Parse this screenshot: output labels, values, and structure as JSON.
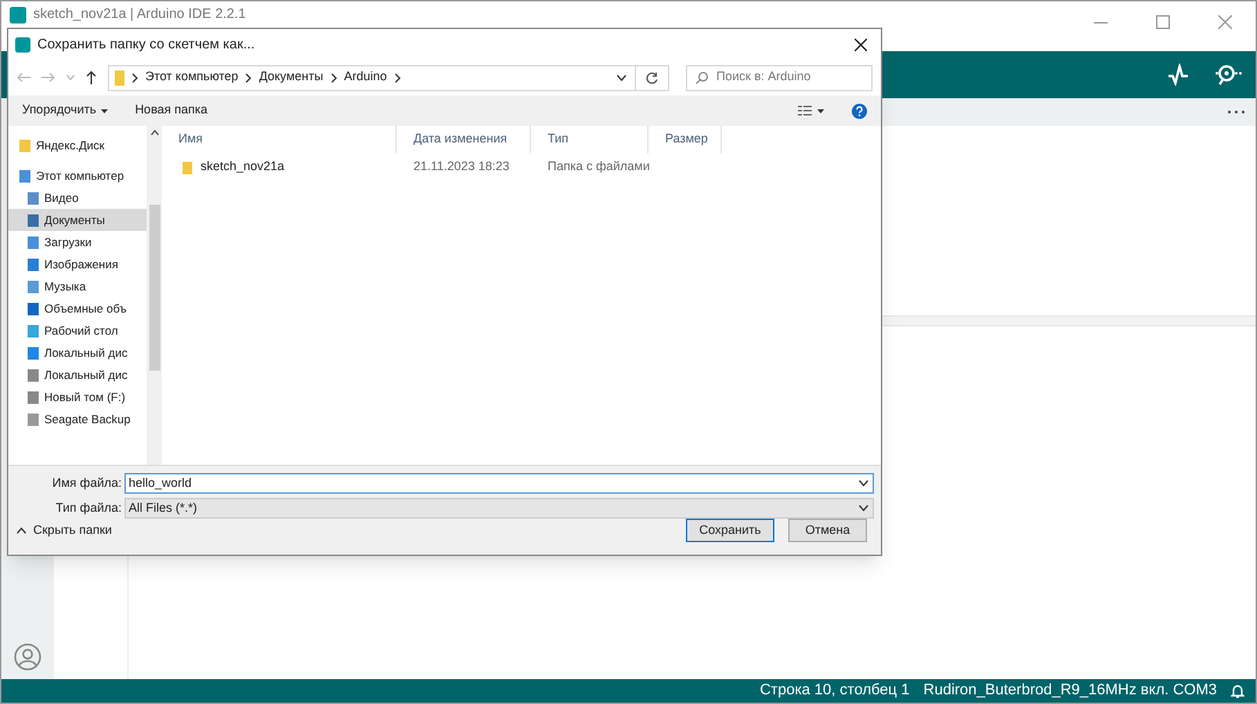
{
  "window": {
    "title": "sketch_nov21a | Arduino IDE 2.2.1"
  },
  "status_bar": {
    "position": "Строка 10, столбец 1",
    "board": "Rudiron_Buterbrod_R9_16MHz вкл. COM3"
  },
  "dialog": {
    "title": "Сохранить папку со скетчем как...",
    "breadcrumbs": [
      "Этот компьютер",
      "Документы",
      "Arduino"
    ],
    "search": {
      "placeholder": "Поиск в: Arduino"
    },
    "toolbar": {
      "organize": "Упорядочить",
      "new_folder": "Новая папка"
    },
    "nav": [
      {
        "label": "Яндекс.Диск",
        "selected": false
      },
      {
        "label": "Этот компьютер",
        "selected": false,
        "children": [
          {
            "label": "Видео",
            "selected": false
          },
          {
            "label": "Документы",
            "selected": true
          },
          {
            "label": "Загрузки",
            "selected": false
          },
          {
            "label": "Изображения",
            "selected": false
          },
          {
            "label": "Музыка",
            "selected": false
          },
          {
            "label": "Объемные объ",
            "selected": false
          },
          {
            "label": "Рабочий стол",
            "selected": false
          },
          {
            "label": "Локальный дис",
            "selected": false
          },
          {
            "label": "Локальный дис",
            "selected": false
          },
          {
            "label": "Новый том (F:)",
            "selected": false
          },
          {
            "label": "Seagate Backup",
            "selected": false
          }
        ]
      }
    ],
    "columns": [
      "Имя",
      "Дата изменения",
      "Тип",
      "Размер"
    ],
    "rows": [
      {
        "name": "sketch_nov21a",
        "date": "21.11.2023 18:23",
        "type": "Папка с файлами"
      }
    ],
    "file_name": {
      "label": "Имя файла:",
      "value": "hello_world"
    },
    "file_type": {
      "label": "Тип файла:",
      "value": "All Files (*.*)"
    },
    "hide_folders": "Скрыть папки",
    "buttons": [
      "Сохранить",
      "Отмена"
    ]
  }
}
